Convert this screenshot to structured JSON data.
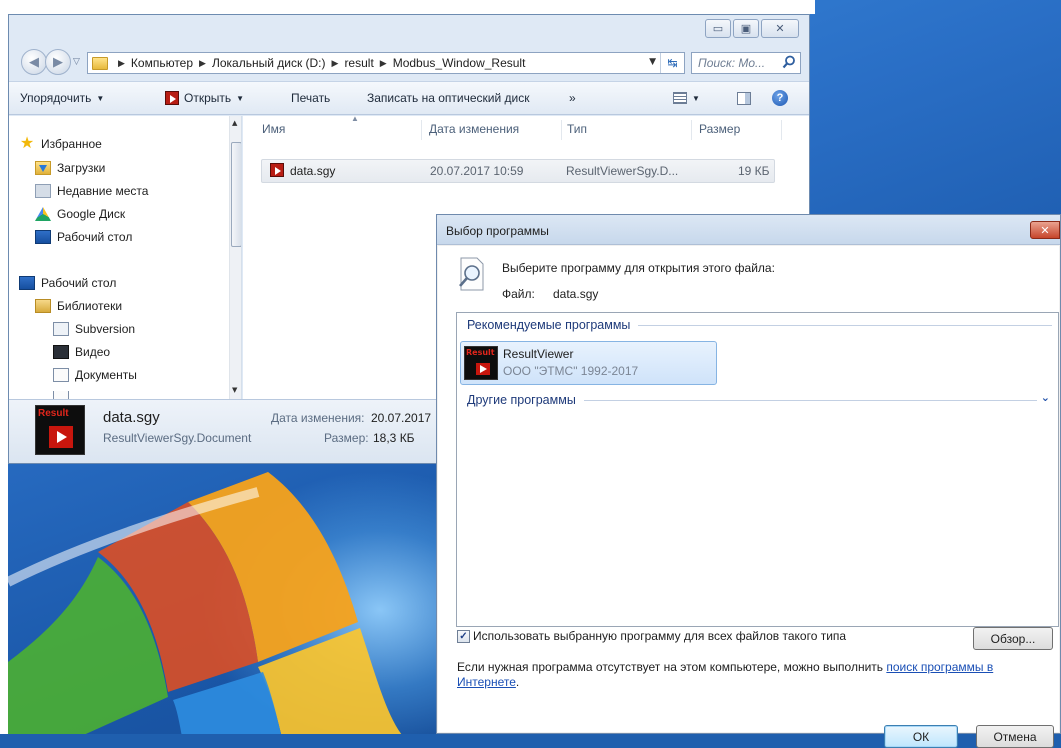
{
  "explorer": {
    "breadcrumb": [
      "Компьютер",
      "Локальный диск (D:)",
      "result",
      "Modbus_Window_Result"
    ],
    "search_placeholder": "Поиск: Mo...",
    "toolbar": {
      "organize": "Упорядочить",
      "open": "Открыть",
      "print": "Печать",
      "burn": "Записать на оптический диск",
      "more": "»"
    },
    "nav": {
      "favorites": "Избранное",
      "downloads": "Загрузки",
      "recent": "Недавние места",
      "google_drive": "Google Диск",
      "desktop_fav": "Рабочий стол",
      "desktop": "Рабочий стол",
      "libraries": "Библиотеки",
      "subversion": "Subversion",
      "video": "Видео",
      "documents": "Документы"
    },
    "columns": {
      "name": "Имя",
      "modified": "Дата изменения",
      "type": "Тип",
      "size": "Размер"
    },
    "file": {
      "name": "data.sgy",
      "modified": "20.07.2017 10:59",
      "type": "ResultViewerSgy.D...",
      "size": "19 КБ"
    },
    "details": {
      "name": "data.sgy",
      "type": "ResultViewerSgy.Document",
      "modified_label": "Дата изменения:",
      "modified_value": "20.07.2017",
      "size_label": "Размер:",
      "size_value": "18,3 КБ",
      "icon_text": "Result"
    }
  },
  "dialog": {
    "title": "Выбор программы",
    "prompt": "Выберите программу для открытия этого файла:",
    "file_label": "Файл:",
    "file_value": "data.sgy",
    "recommended_header": "Рекомендуемые программы",
    "program": {
      "name": "ResultViewer",
      "publisher": "ООО \"ЭТМС\" 1992-2017",
      "icon_text": "Result"
    },
    "other_header": "Другие программы",
    "checkbox_label": "Использовать выбранную программу для всех файлов такого типа",
    "checkbox_checked": true,
    "browse_button": "Обзор...",
    "info_text": "Если нужная программа отсутствует на этом компьютере, можно выполнить ",
    "info_link": "поиск программы в Интернете",
    "info_end": ".",
    "ok_button": "ОК",
    "cancel_button": "Отмена"
  },
  "colors": {
    "desktop": "#1f5fae",
    "link": "#1a4fb5",
    "header_text": "#1e3a7a",
    "result_red": "#c8160d"
  }
}
